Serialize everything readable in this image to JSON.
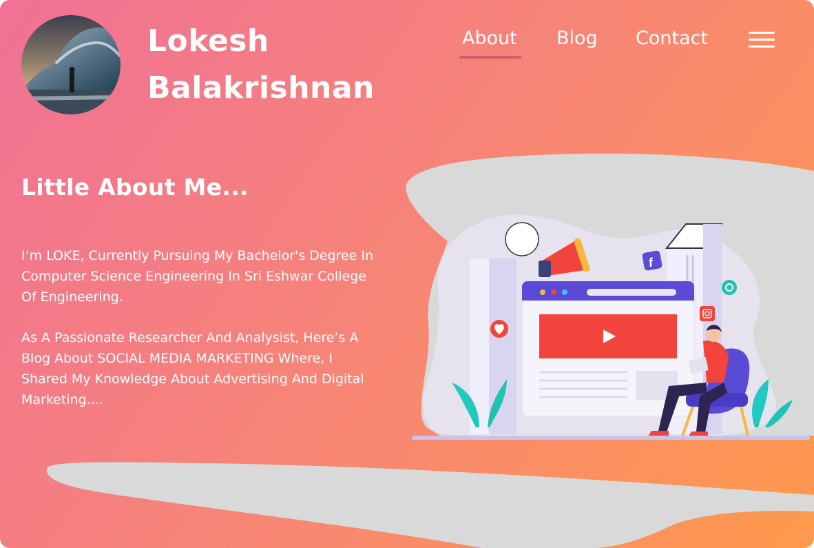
{
  "header": {
    "name_line1": "Lokesh",
    "name_line2": "Balakrishnan"
  },
  "nav": {
    "about": "About",
    "blog": "Blog",
    "contact": "Contact",
    "active": "About"
  },
  "main": {
    "heading": "Little About Me...",
    "paragraph1": "I’m LOKE, Currently Pursuing My Bachelor's Degree In Computer Science Engineering In Sri Eshwar College Of Engineering.",
    "paragraph2": "As A Passionate Researcher And Analysist, Here’s A Blog About SOCIAL MEDIA MARKETING Where, I Shared My Knowledge About Advertising And Digital Marketing...."
  },
  "colors": {
    "gradient_start": "#f07195",
    "gradient_end": "#fe9a4c",
    "blob_gray": "#d9d9d9",
    "accent_purple": "#6c5ce7",
    "accent_red": "#f0443c"
  },
  "icons": [
    "avatar-image",
    "menu-icon",
    "megaphone-icon",
    "facebook-icon",
    "instagram-icon",
    "heart-icon",
    "play-icon",
    "chat-icon"
  ]
}
